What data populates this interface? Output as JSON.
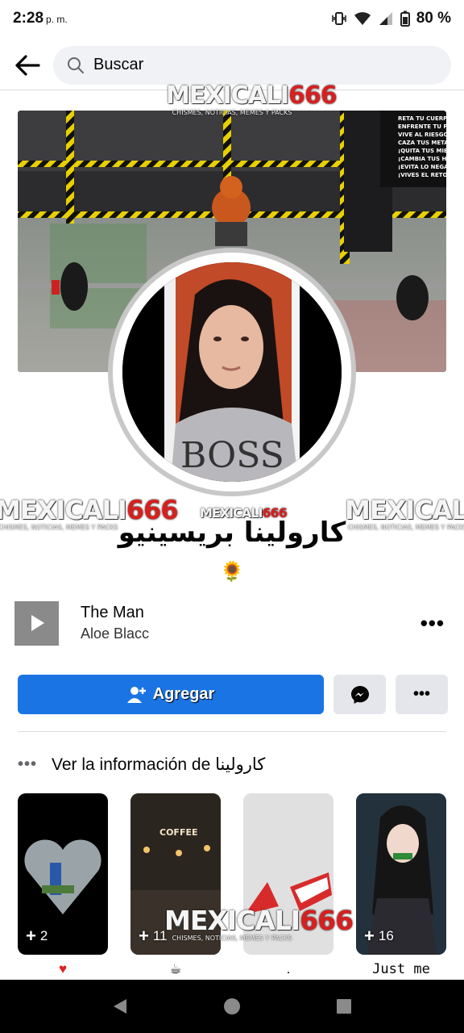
{
  "status_bar": {
    "time": "2:28",
    "ampm": "p. m.",
    "battery": "80 %"
  },
  "search": {
    "placeholder": "Buscar"
  },
  "watermark": {
    "brand_text": "MEXICALI",
    "brand_number": "666",
    "tagline": "CHISMES, NOTICIAS, MEMES Y PACKS"
  },
  "cover": {
    "poster_lines": [
      "RETA TU CUERPO",
      "ENFRENTE TU FORTALEZA",
      "VIVE AL RIESGO",
      "CAZA TUS METAS",
      "¡QUITA TUS MIEDOS",
      "¡CAMBIA TUS HÁBITOS",
      "¡EVITA LO NEGATIVO",
      "¡VIVES EL RETO?"
    ]
  },
  "profile": {
    "name": "كارولينا بريسينيو",
    "bio_emoji": "🌻",
    "shirt_text": "BOSS"
  },
  "music": {
    "title": "The Man",
    "artist": "Aloe Blacc",
    "more_label": "•••"
  },
  "actions": {
    "add_label": "Agregar",
    "more_label": "•••"
  },
  "info": {
    "dots": "•••",
    "text": "Ver la información de كارولينا"
  },
  "featured": [
    {
      "count": "2",
      "caption": "♥"
    },
    {
      "count": "11",
      "caption": "☕",
      "sign": "COFFEE"
    },
    {
      "count": "",
      "caption": "."
    },
    {
      "count": "16",
      "caption": "Just me"
    }
  ],
  "colors": {
    "primary_blue": "#1b74e4",
    "secondary_gray": "#e4e6eb",
    "search_bg": "#f0f2f5",
    "watermark_red": "#d62020"
  }
}
